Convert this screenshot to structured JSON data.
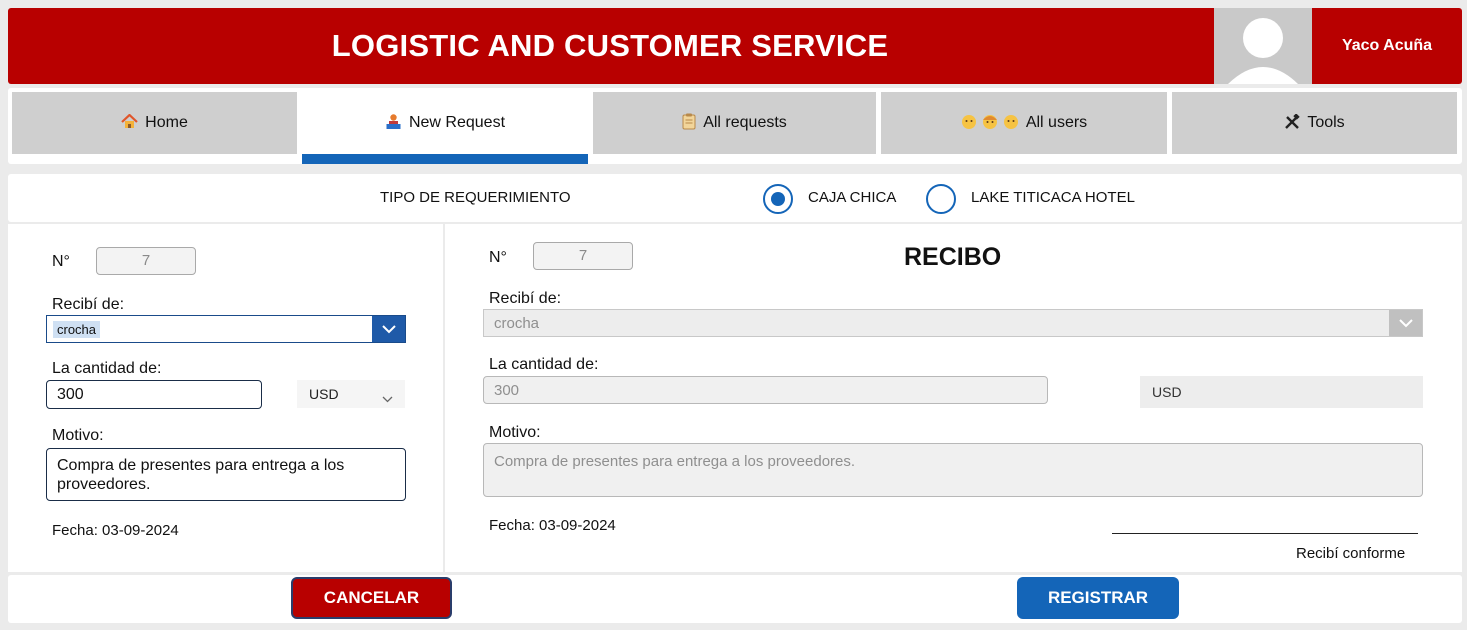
{
  "header": {
    "title": "LOGISTIC AND CUSTOMER SERVICE",
    "user_name": "Yaco Acuña",
    "brand_color": "#b80000"
  },
  "tabs": [
    {
      "label": "Home",
      "icon": "house-icon"
    },
    {
      "label": "New Request",
      "icon": "person-inbox-icon",
      "active": true
    },
    {
      "label": "All requests",
      "icon": "clipboard-icon"
    },
    {
      "label": "All users",
      "icon": "people-icon"
    },
    {
      "label": "Tools",
      "icon": "tools-icon"
    }
  ],
  "request_type": {
    "label": "TIPO DE REQUERIMIENTO",
    "options": [
      "CAJA CHICA",
      "LAKE TITICACA HOTEL"
    ],
    "selected": "CAJA CHICA"
  },
  "form": {
    "number_label": "N°",
    "number_value": "7",
    "received_from_label": "Recibí de:",
    "received_from_value": "crocha",
    "amount_label": "La cantidad de:",
    "amount_value": "300",
    "currency": "USD",
    "reason_label": "Motivo:",
    "reason_value": "Compra de presentes para entrega a los proveedores.",
    "date_text": "Fecha: 03-09-2024"
  },
  "receipt": {
    "title": "RECIBO",
    "number_label": "N°",
    "number_value": "7",
    "received_from_label": "Recibí de:",
    "received_from_value": "crocha",
    "amount_label": "La cantidad de:",
    "amount_value": "300",
    "currency": "USD",
    "reason_label": "Motivo:",
    "reason_value": "Compra de presentes para entrega a los proveedores.",
    "date_text": "Fecha: 03-09-2024",
    "signature_label": "Recibí conforme"
  },
  "actions": {
    "cancel_label": "CANCELAR",
    "register_label": "REGISTRAR",
    "accent_color": "#1465b8"
  }
}
